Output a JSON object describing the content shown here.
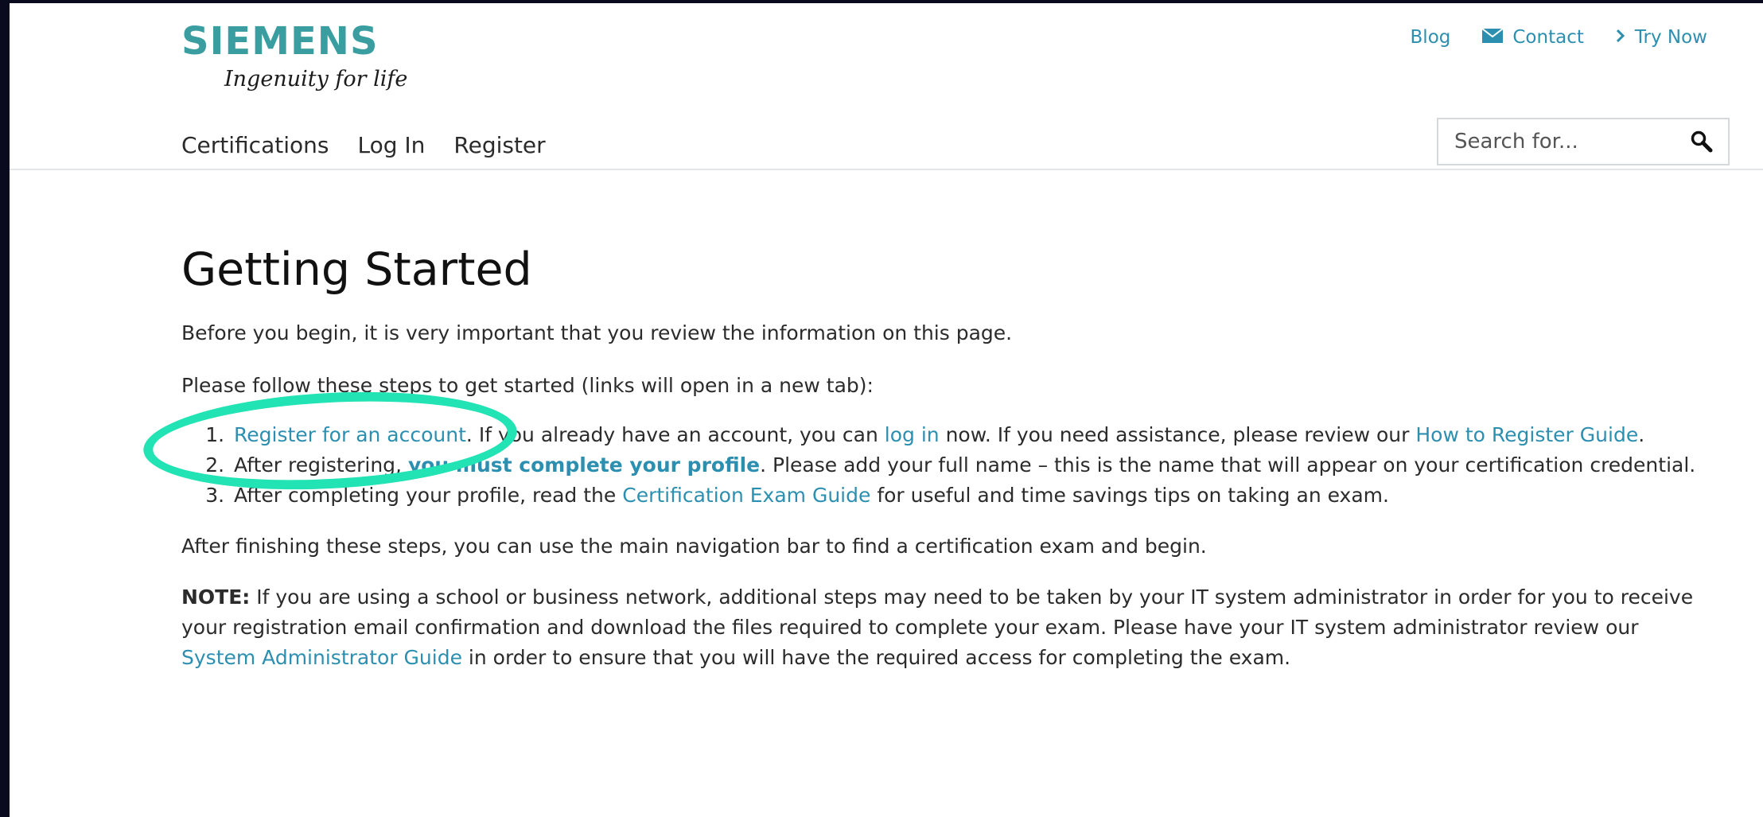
{
  "brand": {
    "name": "SIEMENS",
    "tagline": "Ingenuity for life"
  },
  "top_links": [
    {
      "label": "Blog",
      "icon": ""
    },
    {
      "label": "Contact",
      "icon": "envelope-icon"
    },
    {
      "label": "Try Now",
      "icon": "chevron-right-icon"
    }
  ],
  "nav": {
    "items": [
      "Certifications",
      "Log In",
      "Register"
    ]
  },
  "search": {
    "placeholder": "Search for..."
  },
  "content": {
    "title": "Getting Started",
    "intro": "Before you begin, it is very important that you review the information on this page.",
    "follow": "Please follow these steps to get started (links will open in a new tab):",
    "steps": [
      {
        "link1": "Register for an account",
        "text1": ". If you already have an account, you can ",
        "link2": "log in",
        "text2": " now. If you need assistance, please review our ",
        "link3": "How to Register Guide",
        "text3": "."
      },
      {
        "text1": "After registering, ",
        "link1": "you must complete your profile",
        "text2": ". Please add your full name – this is the name that will appear on your certification credential."
      },
      {
        "text1": "After completing your profile, read the ",
        "link1": "Certification Exam Guide",
        "text2": " for useful and time savings tips on taking an exam."
      }
    ],
    "after": "After finishing these steps, you can use the main navigation bar to find a certification exam and begin.",
    "note": {
      "label": "NOTE:",
      "text1": " If you are using a school or business network, additional steps may need to be taken by your IT system administrator in order for you to receive your registration email confirmation and download the files required to complete your exam.  Please have your IT system administrator review our ",
      "link": "System Administrator Guide",
      "text2": " in order to ensure that you will have the required access for completing the exam."
    }
  },
  "colors": {
    "brand": "#3a9ea0",
    "link": "#2d8fb0",
    "annotation": "#22e3b4",
    "frame": "#0a0a1e"
  }
}
